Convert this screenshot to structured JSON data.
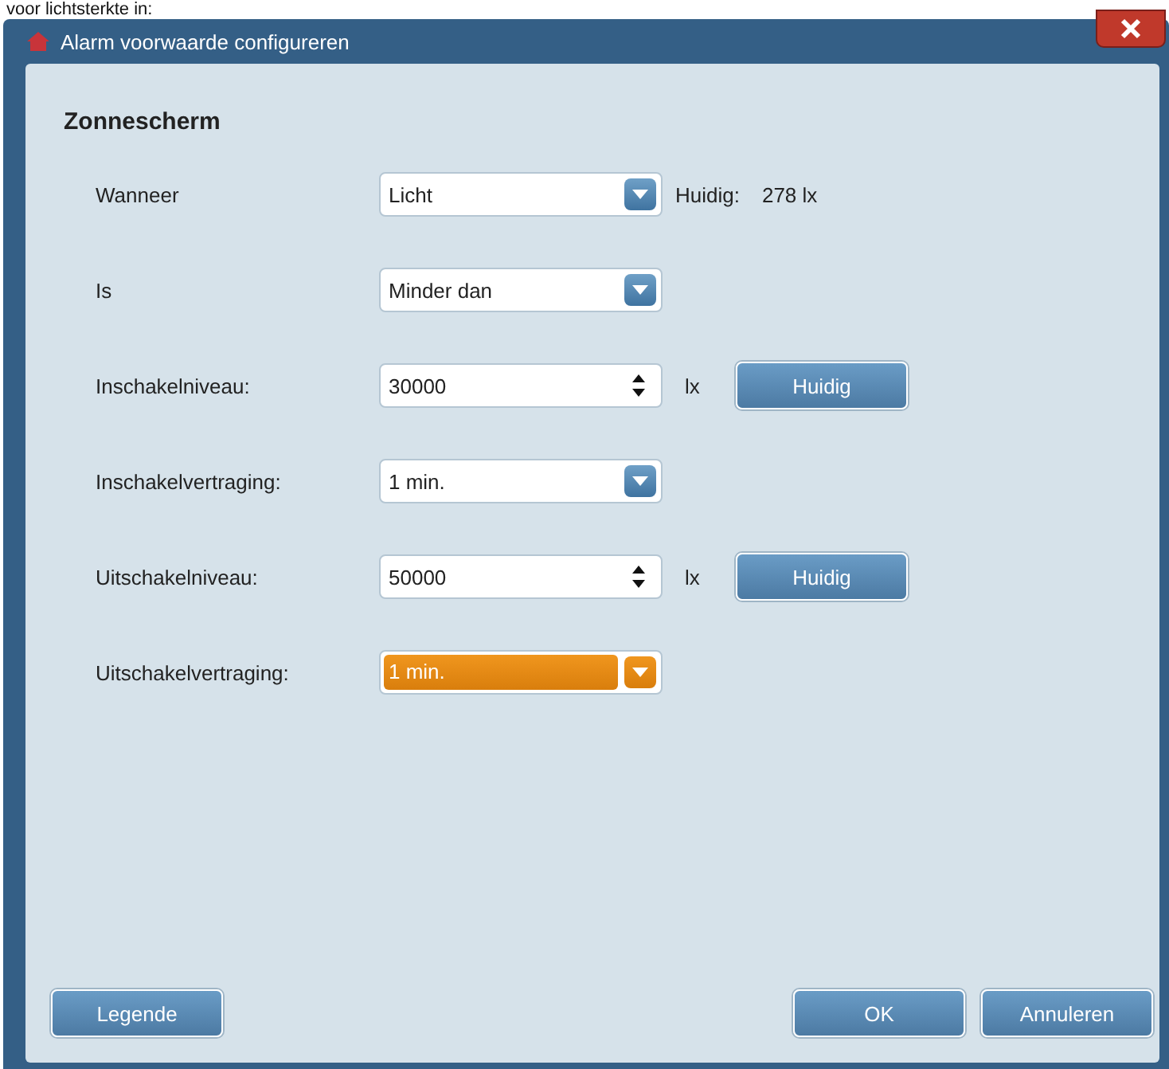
{
  "page_caption": "voor lichtsterkte in:",
  "window": {
    "title": "Alarm voorwaarde configureren"
  },
  "heading": "Zonnescherm",
  "rows": [
    {
      "kind": "dropdown",
      "label": "Wanneer",
      "value": "Licht",
      "focused": false,
      "extra_label": "Huidig:",
      "extra_value": "278 lx"
    },
    {
      "kind": "dropdown",
      "label": "Is",
      "value": "Minder dan",
      "focused": false
    },
    {
      "kind": "spinner",
      "label": "Inschakelniveau:",
      "value": "30000",
      "unit": "lx",
      "button": "Huidig"
    },
    {
      "kind": "dropdown",
      "label": "Inschakelvertraging:",
      "value": "1 min.",
      "focused": false
    },
    {
      "kind": "spinner",
      "label": "Uitschakelniveau:",
      "value": "50000",
      "unit": "lx",
      "button": "Huidig"
    },
    {
      "kind": "dropdown",
      "label": "Uitschakelvertraging:",
      "value": "1 min.",
      "focused": true
    }
  ],
  "buttons": {
    "left": [
      "Legende"
    ],
    "right": [
      "OK",
      "Annuleren"
    ]
  }
}
